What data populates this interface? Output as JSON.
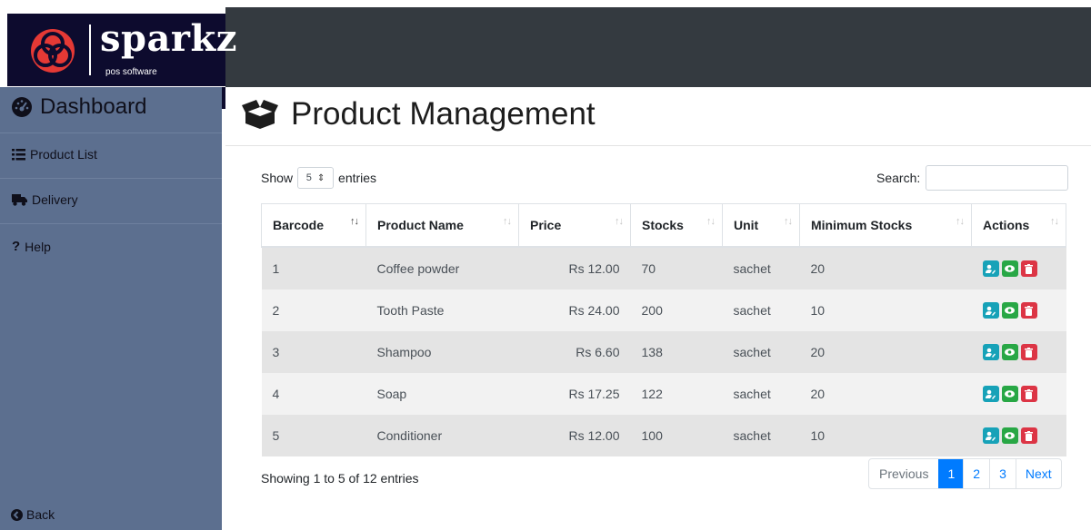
{
  "brand": {
    "name": "sparkz",
    "tagline": "pos software"
  },
  "sidebar": {
    "dashboard": "Dashboard",
    "items": [
      {
        "label": "Product List",
        "icon": "list-icon"
      },
      {
        "label": "Delivery",
        "icon": "truck-icon"
      },
      {
        "label": "Help",
        "icon": "question-icon"
      }
    ],
    "back": "Back"
  },
  "page": {
    "title": "Product Management"
  },
  "table_controls": {
    "show": "Show",
    "length_value": "5",
    "entries": "entries",
    "search_label": "Search:",
    "search_value": ""
  },
  "table": {
    "headers": [
      "Barcode",
      "Product Name",
      "Price",
      "Stocks",
      "Unit",
      "Minimum Stocks",
      "Actions"
    ],
    "rows": [
      {
        "barcode": "1",
        "name": "Coffee powder",
        "price": "Rs 12.00",
        "stocks": "70",
        "unit": "sachet",
        "min": "20"
      },
      {
        "barcode": "2",
        "name": "Tooth Paste",
        "price": "Rs 24.00",
        "stocks": "200",
        "unit": "sachet",
        "min": "10"
      },
      {
        "barcode": "3",
        "name": "Shampoo",
        "price": "Rs 6.60",
        "stocks": "138",
        "unit": "sachet",
        "min": "20"
      },
      {
        "barcode": "4",
        "name": "Soap",
        "price": "Rs 17.25",
        "stocks": "122",
        "unit": "sachet",
        "min": "20"
      },
      {
        "barcode": "5",
        "name": "Conditioner",
        "price": "Rs 12.00",
        "stocks": "100",
        "unit": "sachet",
        "min": "10"
      }
    ]
  },
  "info": "Showing 1 to 5 of 12 entries",
  "pagination": {
    "previous": "Previous",
    "pages": [
      "1",
      "2",
      "3"
    ],
    "next": "Next",
    "active": "1"
  },
  "colors": {
    "sidebar": "#5c6f8f",
    "topbar": "#343a40",
    "logo_bg": "#0d0b2e",
    "edit": "#17a2b8",
    "view": "#28a745",
    "delete": "#dc3545",
    "primary": "#007bff"
  }
}
